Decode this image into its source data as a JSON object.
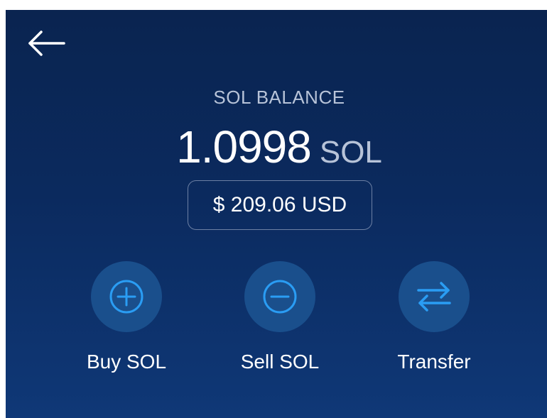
{
  "header": {
    "back_icon": "arrow-left-icon"
  },
  "balance": {
    "label": "SOL BALANCE",
    "amount": "1.0998",
    "unit": "SOL",
    "usd_value": "$ 209.06 USD"
  },
  "actions": [
    {
      "label": "Buy SOL",
      "icon": "plus-circle-icon"
    },
    {
      "label": "Sell SOL",
      "icon": "minus-circle-icon"
    },
    {
      "label": "Transfer",
      "icon": "transfer-arrows-icon"
    }
  ],
  "colors": {
    "background_top": "#0a2450",
    "background_bottom": "#0f3877",
    "accent": "#2a9df4",
    "action_circle": "#1a4f8c",
    "muted_text": "#b7c3d8"
  }
}
